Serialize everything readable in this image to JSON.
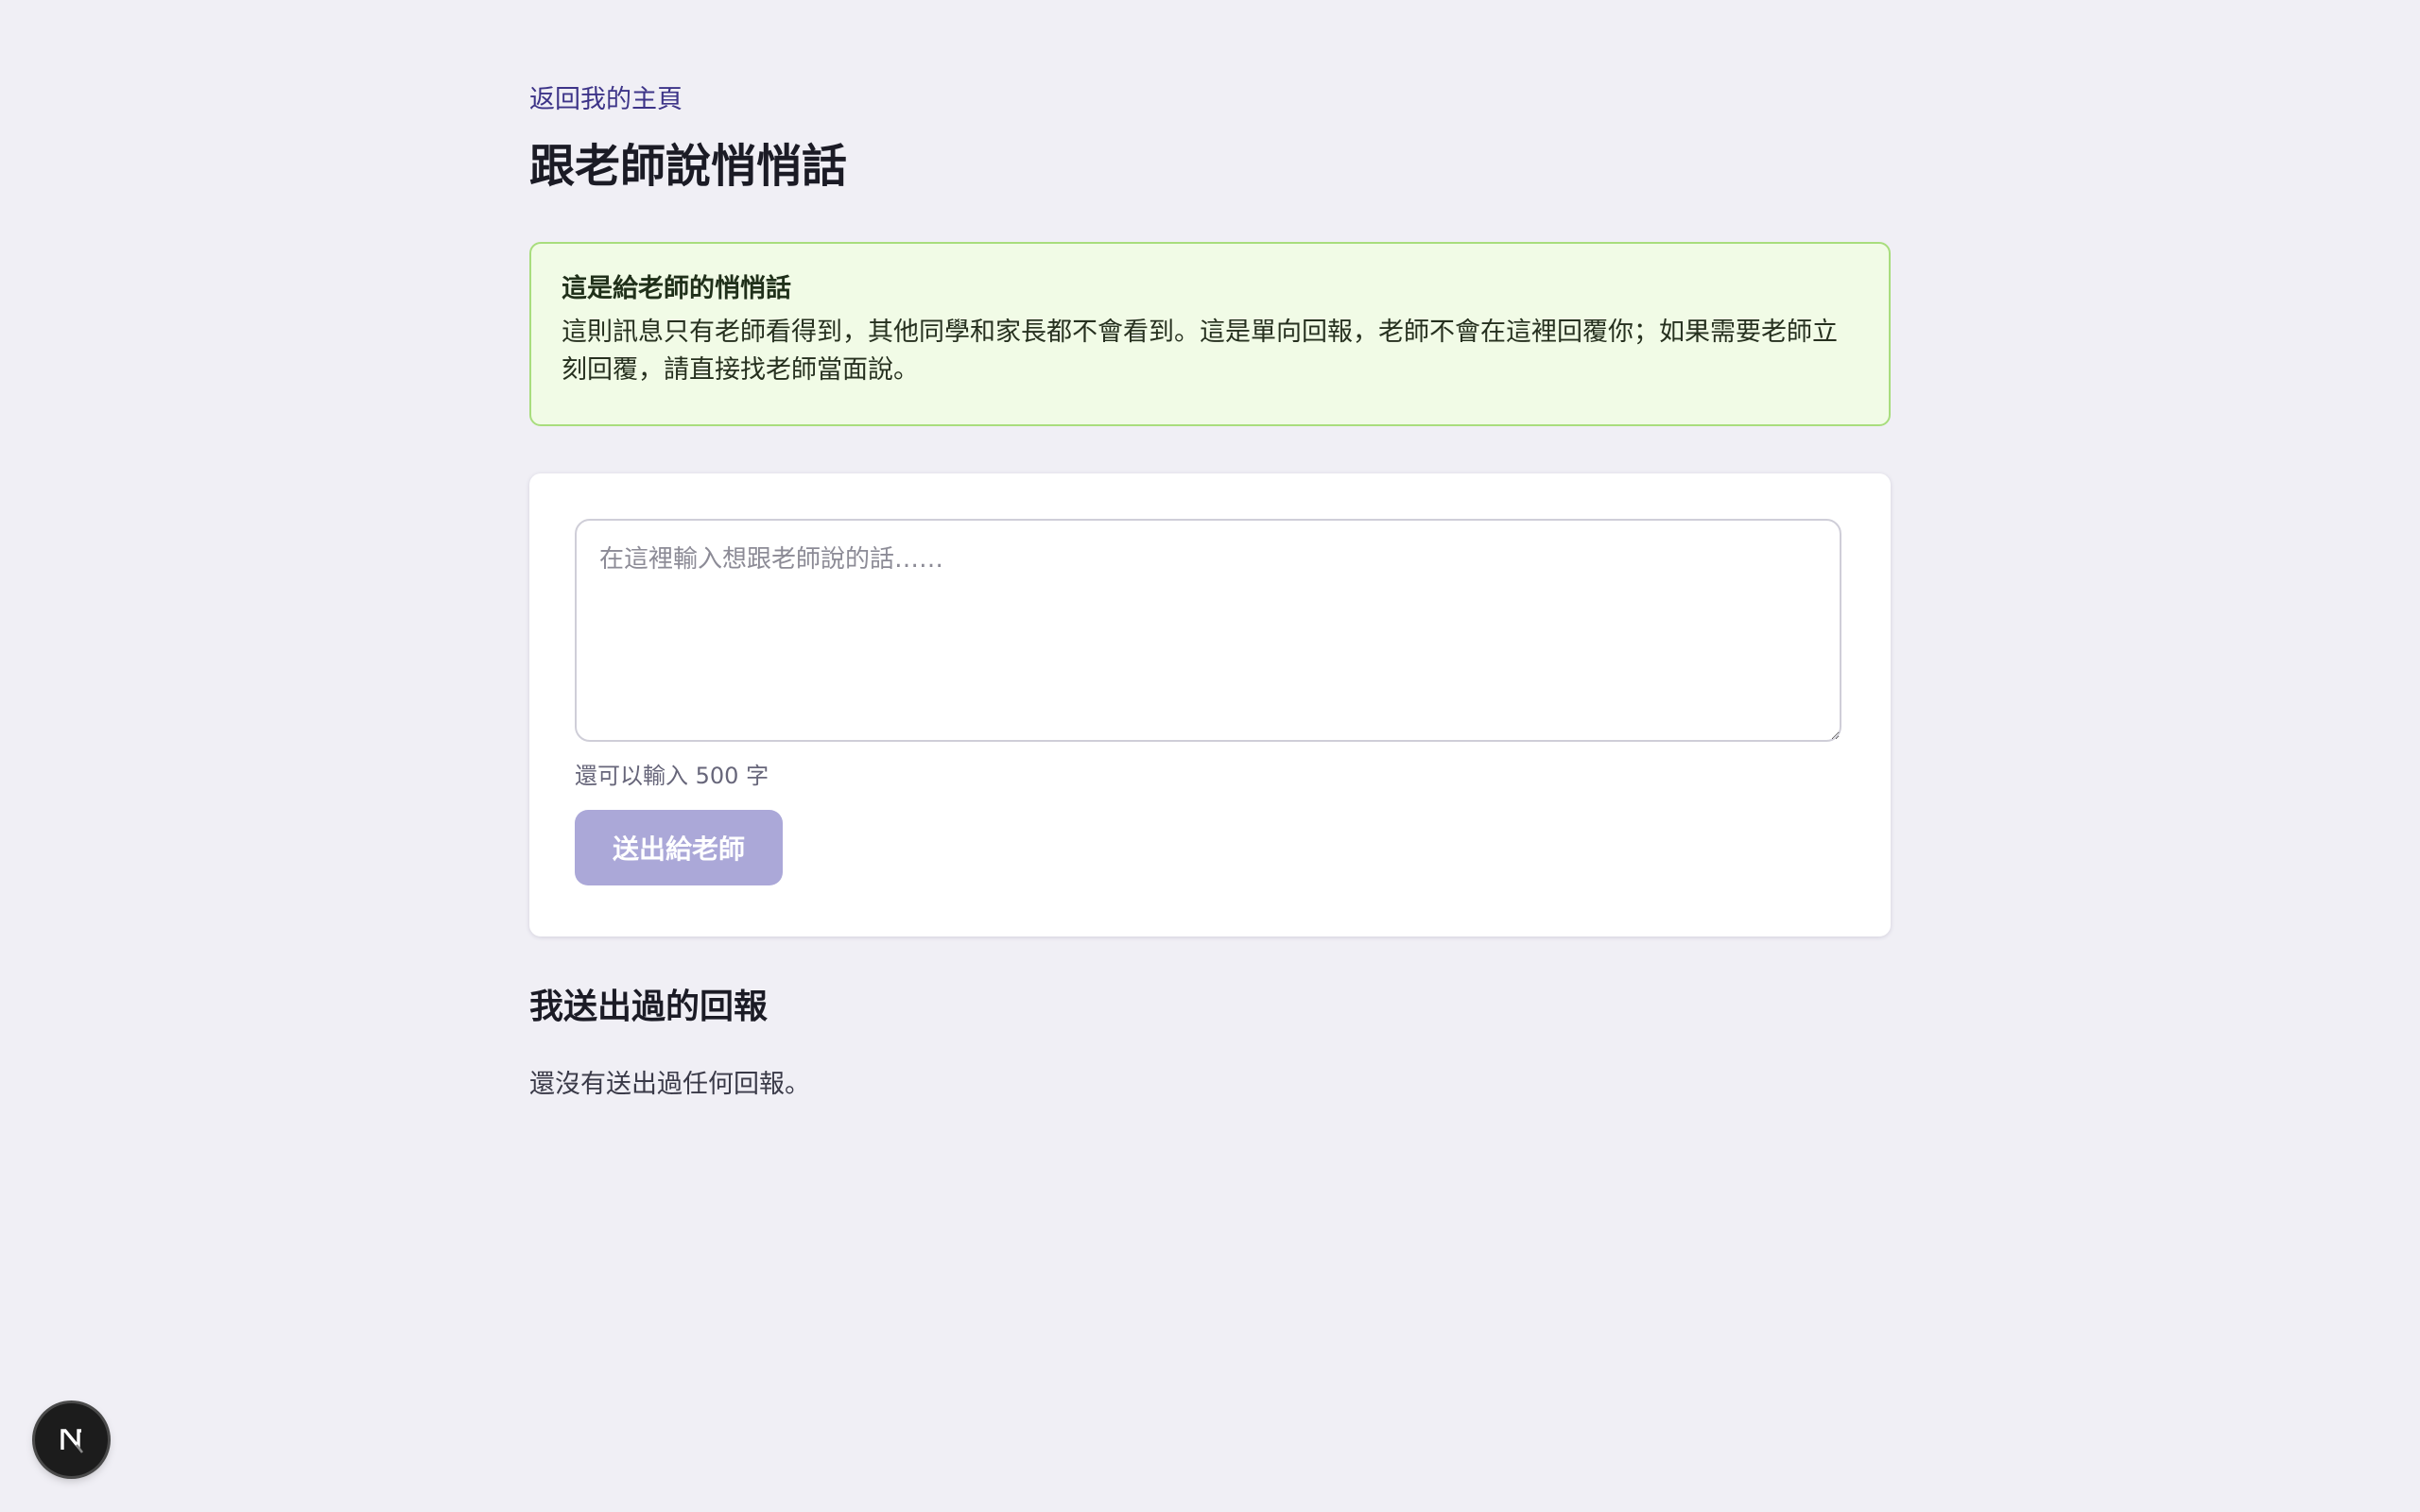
{
  "header": {
    "back_link": "返回我的主頁",
    "title": "跟老師說悄悄話"
  },
  "notice": {
    "title": "這是給老師的悄悄話",
    "body": "這則訊息只有老師看得到，其他同學和家長都不會看到。這是單向回報，老師不會在這裡回覆你；如果需要老師立刻回覆，請直接找老師當面說。"
  },
  "form": {
    "message_value": "",
    "message_placeholder": "在這裡輸入想跟老師說的話……",
    "char_count": "還可以輸入 500 字",
    "send_label": "送出給老師"
  },
  "history": {
    "title": "我送出過的回報",
    "empty_text": "還沒有送出過任何回報。"
  },
  "dev_badge": {
    "icon": "nextjs-logo-icon",
    "letter": "N"
  },
  "colors": {
    "background": "#f0eff5",
    "accent": "#3d3488",
    "notice_bg": "#f1fbe6",
    "notice_border": "#a8dd7d",
    "button_disabled": "#aba8d8"
  }
}
